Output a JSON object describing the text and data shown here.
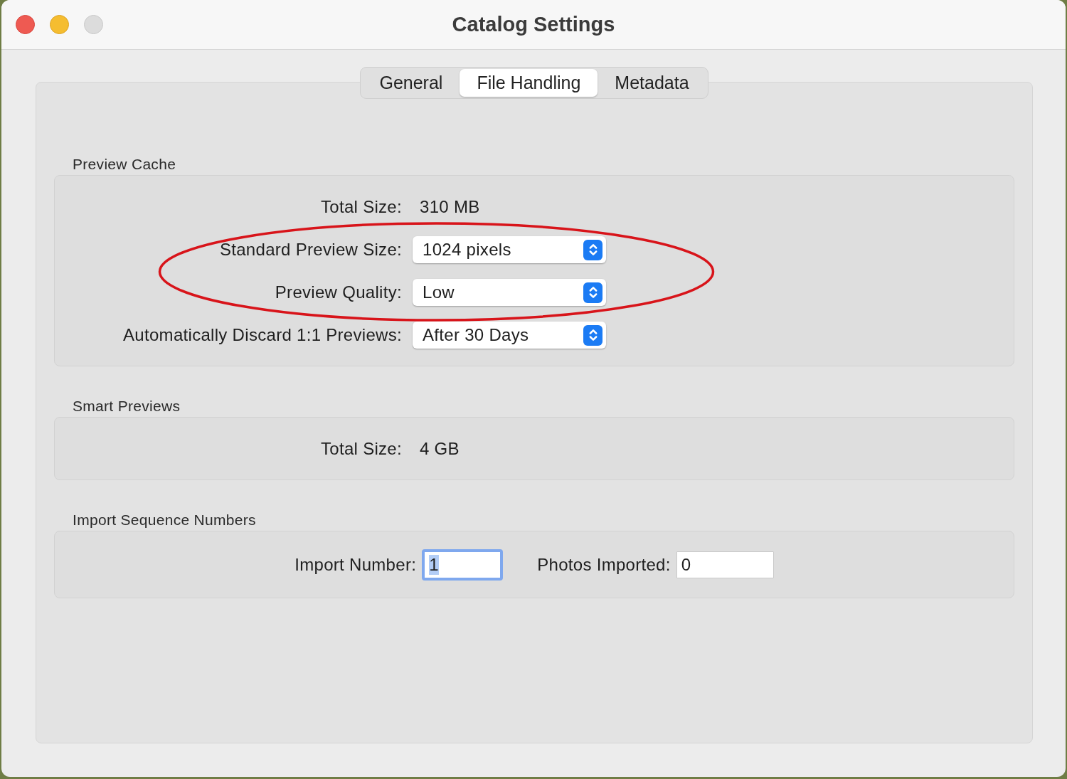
{
  "window": {
    "title": "Catalog Settings"
  },
  "tabs": [
    {
      "label": "General",
      "selected": false
    },
    {
      "label": "File Handling",
      "selected": true
    },
    {
      "label": "Metadata",
      "selected": false
    }
  ],
  "sections": [
    {
      "title": "Preview Cache",
      "rows": [
        {
          "kind": "text",
          "label": "Total Size:",
          "value": "310 MB"
        },
        {
          "kind": "select",
          "label": "Standard Preview Size:",
          "value": "1024 pixels"
        },
        {
          "kind": "select",
          "label": "Preview Quality:",
          "value": "Low"
        },
        {
          "kind": "select",
          "label": "Automatically Discard 1:1 Previews:",
          "value": "After 30 Days"
        }
      ]
    },
    {
      "title": "Smart Previews",
      "rows": [
        {
          "kind": "text",
          "label": "Total Size:",
          "value": "4 GB"
        }
      ]
    },
    {
      "title": "Import Sequence Numbers",
      "fields": [
        {
          "label": "Import Number:",
          "value": "1",
          "focused": true
        },
        {
          "label": "Photos Imported:",
          "value": "0",
          "focused": false
        }
      ]
    }
  ]
}
